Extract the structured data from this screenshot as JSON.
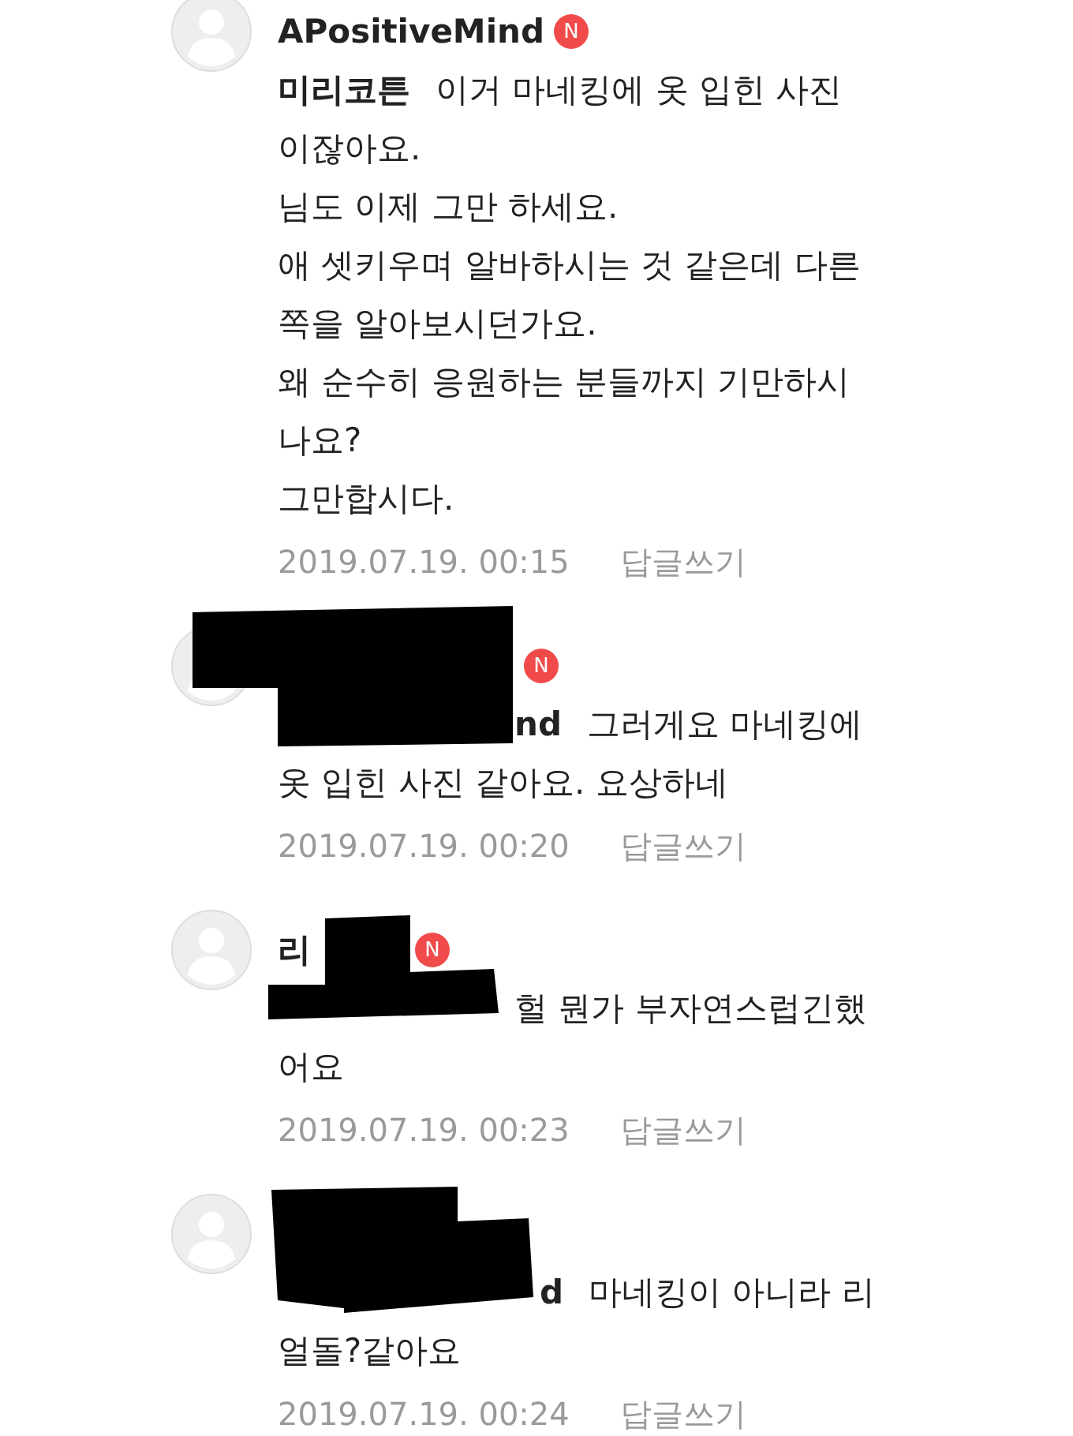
{
  "comments": [
    {
      "author": "APositiveMind",
      "badge": "N",
      "mention": "미리코튼",
      "lines": [
        "이거 마네킹에 옷 입힌 사진",
        "이잖아요.",
        "님도 이제 그만 하세요.",
        "애 셋키우며 알바하시는 것 같은데 다른",
        "쪽을 알아보시던가요.",
        "왜 순수히 응원하는 분들까지 기만하시",
        "나요?",
        "그만합시다."
      ],
      "date": "2019.07.19. 00:15",
      "reply_label": "답글쓰기"
    },
    {
      "badge": "N",
      "redacted": true,
      "mention": "nd",
      "lines": [
        "그러게요 마네킹에",
        "옷 입힌 사진 같아요. 요상하네"
      ],
      "date": "2019.07.19. 00:20",
      "reply_label": "답글쓰기"
    },
    {
      "author": "리",
      "badge": "N",
      "redacted": true,
      "lines": [
        "헐 뭔가 부자연스럽긴했",
        "어요"
      ],
      "date": "2019.07.19. 00:23",
      "reply_label": "답글쓰기"
    },
    {
      "redacted": true,
      "mention": "d",
      "lines": [
        "마네킹이 아니라 리",
        "얼돌?같아요"
      ],
      "date": "2019.07.19. 00:24",
      "reply_label": "답글쓰기"
    }
  ]
}
